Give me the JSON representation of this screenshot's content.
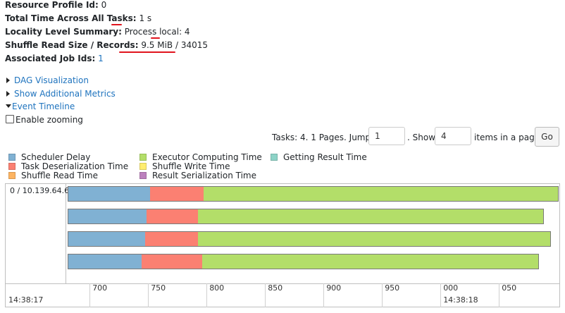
{
  "summary": {
    "resource_profile_label": "Resource Profile Id:",
    "resource_profile_value": "0",
    "total_time_label": "Total Time Across All Tasks:",
    "total_time_value": "1 s",
    "locality_label": "Locality Level Summary:",
    "locality_value": "Process local: 4",
    "shuffle_label": "Shuffle Read Size / Records:",
    "shuffle_value": "9.5 MiB / 34015",
    "jobs_label": "Associated Job Ids:",
    "jobs_value": "1"
  },
  "links": {
    "dag": "DAG Visualization",
    "metrics": "Show Additional Metrics",
    "timeline": "Event Timeline"
  },
  "zoom_label": "Enable zooming",
  "pager": {
    "prefix": "Tasks: 4. 1 Pages. Jump to",
    "page_value": "1",
    "show_label": ". Show",
    "size_value": "4",
    "suffix": "items in a page.",
    "go_label": "Go"
  },
  "legend": [
    {
      "label": "Scheduler Delay",
      "color": "#80b1d3"
    },
    {
      "label": "Task Deserialization Time",
      "color": "#fb8072"
    },
    {
      "label": "Shuffle Read Time",
      "color": "#fdb462"
    },
    {
      "label": "Executor Computing Time",
      "color": "#b3de69"
    },
    {
      "label": "Shuffle Write Time",
      "color": "#ffed6f"
    },
    {
      "label": "Result Serialization Time",
      "color": "#bc80bd"
    },
    {
      "label": "Getting Result Time",
      "color": "#8dd3c7"
    }
  ],
  "timeline": {
    "executor_label": "0 / 10.139.64.6",
    "ticks": [
      "700",
      "750",
      "800",
      "850",
      "900",
      "950",
      "000",
      "050"
    ],
    "time_labels": [
      "14:38:17",
      "14:38:18"
    ],
    "tasks": [
      {
        "start": 680,
        "scheduler_delay": 70,
        "deserialization": 46,
        "computing": 304
      },
      {
        "start": 680,
        "scheduler_delay": 67,
        "deserialization": 44,
        "computing": 296
      },
      {
        "start": 680,
        "scheduler_delay": 66,
        "deserialization": 45,
        "computing": 302
      },
      {
        "start": 680,
        "scheduler_delay": 63,
        "deserialization": 52,
        "computing": 288
      }
    ]
  }
}
